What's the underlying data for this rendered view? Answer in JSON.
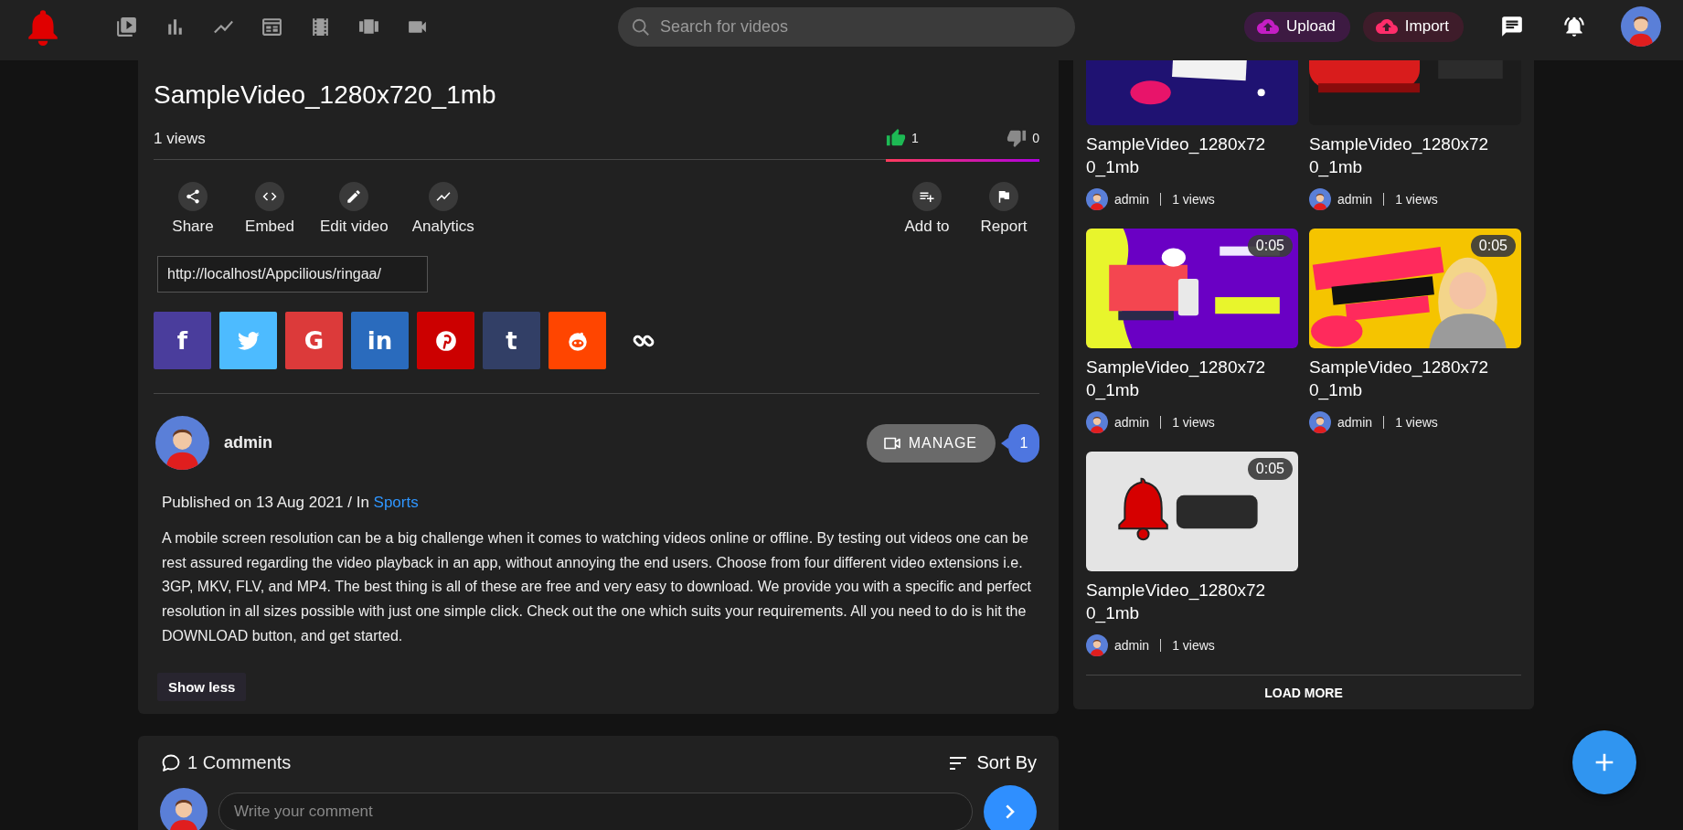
{
  "top_bar": {
    "search": {
      "placeholder": "Search for videos"
    },
    "buttons": [
      {
        "label": "Upload",
        "kind": "upload"
      },
      {
        "label": "Import",
        "kind": "import"
      }
    ]
  },
  "video": {
    "title": "SampleVideo_1280x720_1mb",
    "views": "1 views",
    "likes": "1",
    "dislikes": "0",
    "rating": {
      "level": 1
    }
  },
  "actions": [
    {
      "label": "Share"
    },
    {
      "label": "Embed"
    },
    {
      "label": "Edit video"
    },
    {
      "label": "Analytics"
    }
  ],
  "secondary_actions": [
    {
      "label": "Add to"
    },
    {
      "label": "Report"
    }
  ],
  "share_url": "http://localhost/Appcilious/ringaa/",
  "share_buttons": [
    {
      "kind": "facebook",
      "color": "#4a3d9c",
      "glyph": "f"
    },
    {
      "kind": "twitter",
      "color": "#4dbbff"
    },
    {
      "kind": "google",
      "color": "#dc3a3a",
      "glyph": "G"
    },
    {
      "kind": "linkedin",
      "color": "#2a6bbd",
      "glyph": "in"
    },
    {
      "kind": "pinterest",
      "color": "#cc0000"
    },
    {
      "kind": "tumblr",
      "color": "#323f66",
      "glyph": "t"
    },
    {
      "kind": "reddit",
      "color": "#ff4500"
    },
    {
      "kind": "link"
    }
  ],
  "channel": {
    "name": "admin",
    "manage": "MANAGE",
    "count": "1"
  },
  "published": {
    "text": "Published on 13 Aug 2021 / In",
    "category": "Sports"
  },
  "description": "A mobile screen resolution can be a big challenge when it comes to watching videos online or offline. By testing out videos one can be rest assured regarding the video playback in an app, without annoying the end users. Choose from four different video extensions i.e. 3GP, MKV, FLV, and MP4. The best thing is all of these are free and very easy to download. We provide you with a specific and perfect resolution in all sizes possible with just one simple click. Check out the one which suits your requirements. All you need to do is hit the DOWNLOAD button, and get started.",
  "show_less": "Show less",
  "comments": {
    "title": "1 Comments",
    "sort": "Sort By",
    "placeholder": "Write your comment"
  },
  "related": {
    "items": [
      {
        "title": "SampleVideo_1280x720_1mb",
        "author": "admin",
        "views": "1 views"
      },
      {
        "title": "SampleVideo_1280x720_1mb",
        "author": "admin",
        "views": "1 views"
      },
      {
        "title": "SampleVideo_1280x720_1mb",
        "author": "admin",
        "views": "1 views",
        "duration": "0:05"
      },
      {
        "title": "SampleVideo_1280x720_1mb",
        "author": "admin",
        "views": "1 views",
        "duration": "0:05"
      },
      {
        "title": "SampleVideo_1280x720_1mb",
        "author": "admin",
        "views": "1 views",
        "duration": "0:05"
      }
    ],
    "load_more": "LOAD MORE"
  }
}
